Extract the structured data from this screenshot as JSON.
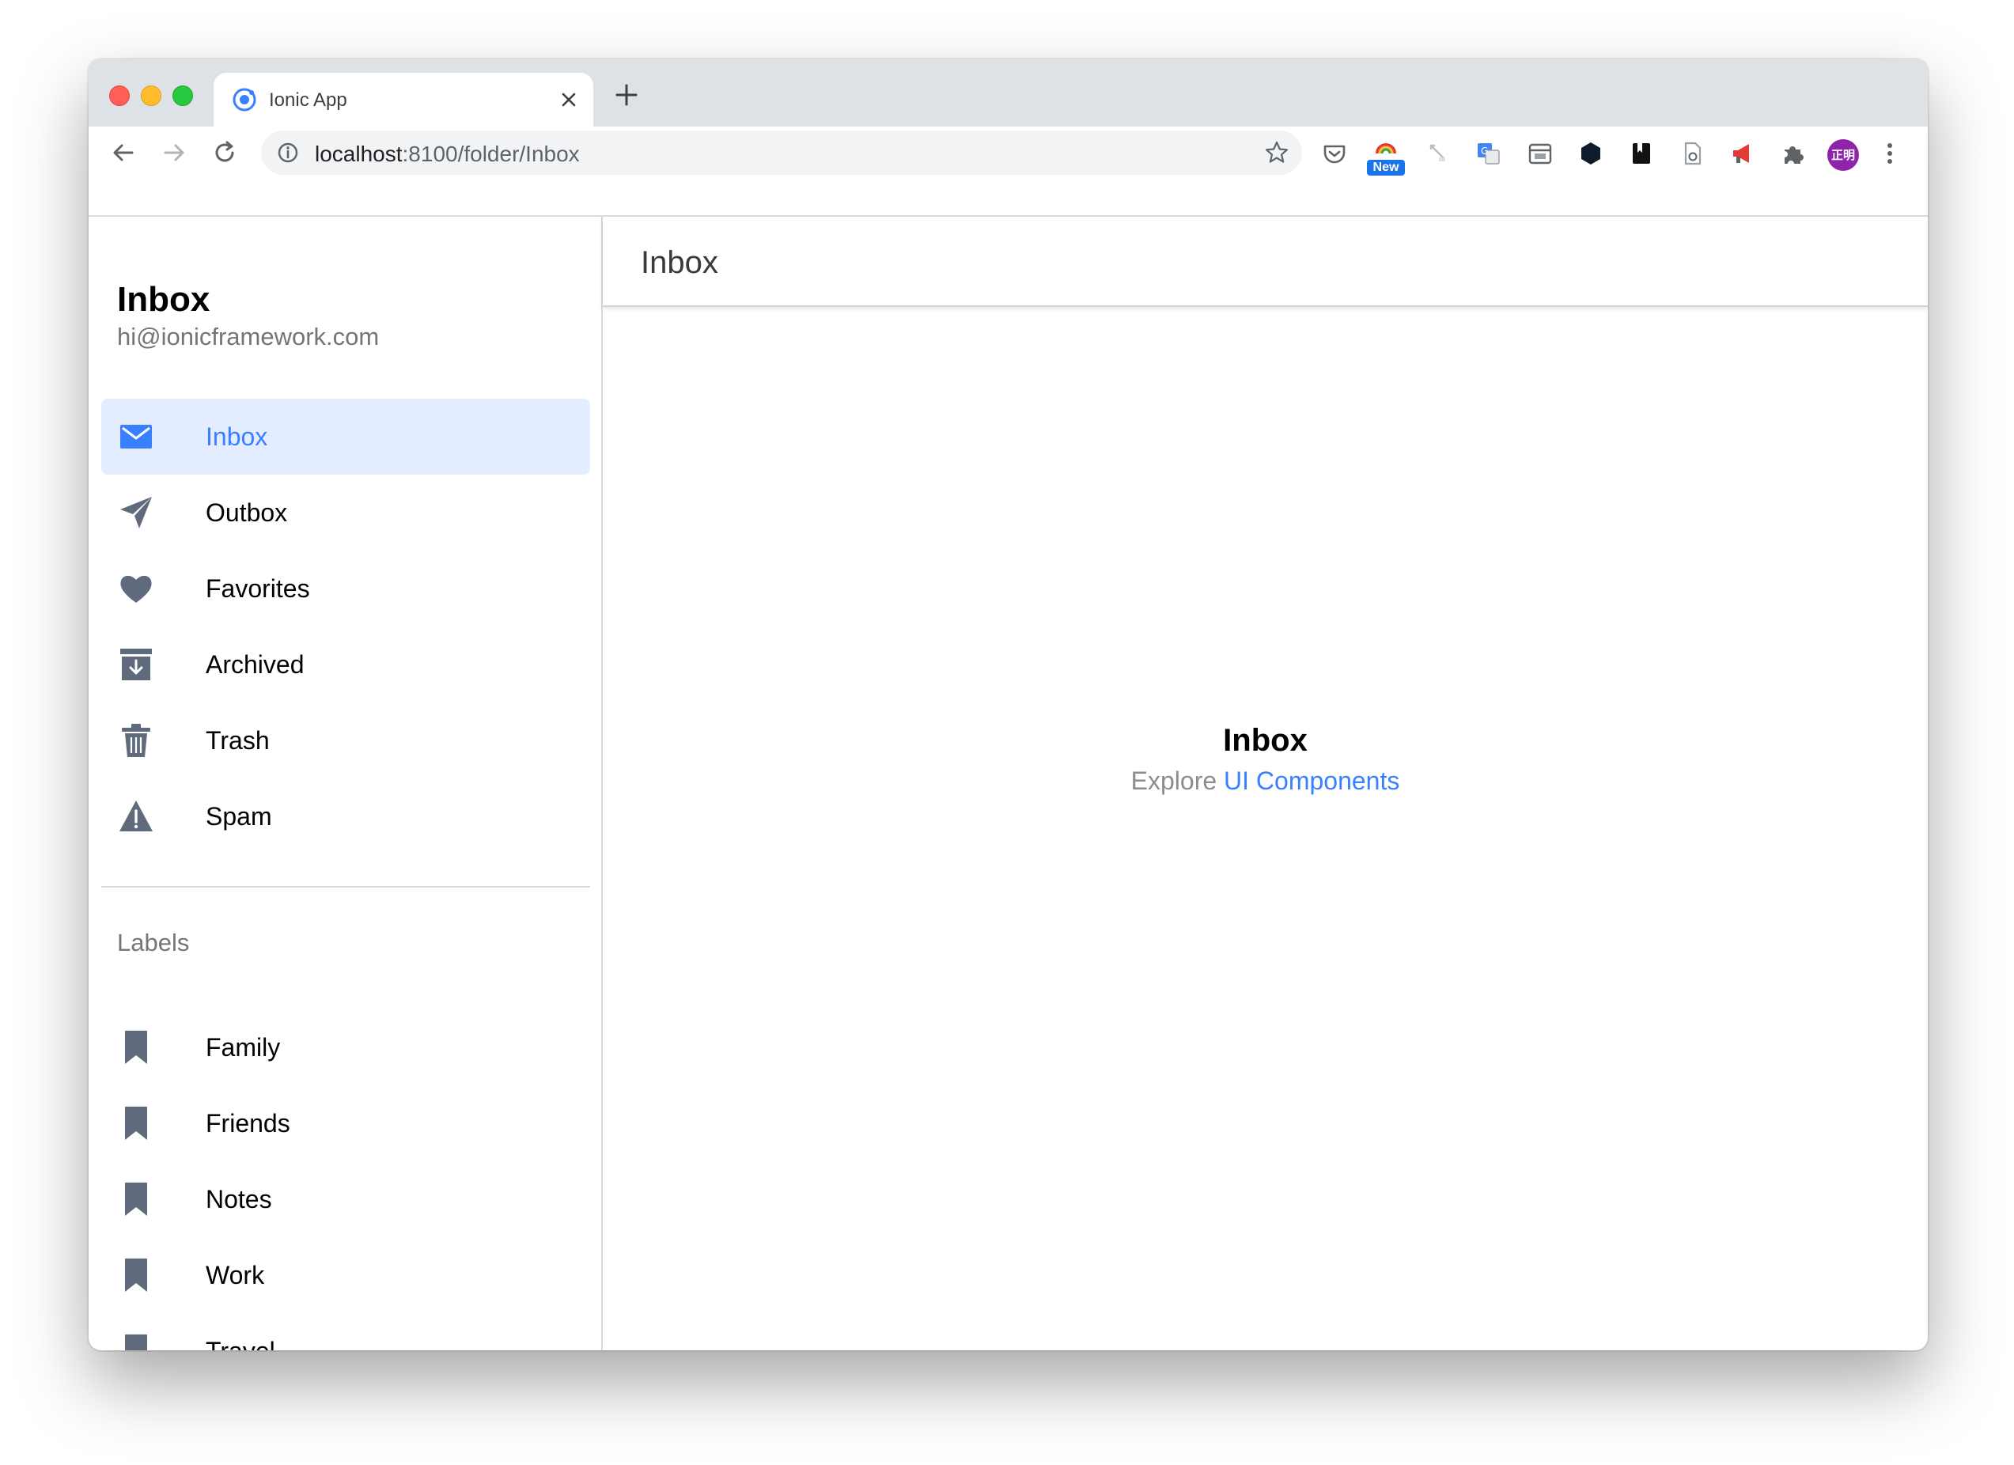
{
  "browser": {
    "tab_title": "Ionic App",
    "url_host": "localhost",
    "url_path": ":8100/folder/Inbox",
    "new_badge": "New",
    "avatar_text": "正明"
  },
  "menu": {
    "title": "Inbox",
    "note": "hi@ionicframework.com",
    "items": [
      {
        "label": "Inbox",
        "icon": "mail-icon"
      },
      {
        "label": "Outbox",
        "icon": "paper-plane-icon"
      },
      {
        "label": "Favorites",
        "icon": "heart-icon"
      },
      {
        "label": "Archived",
        "icon": "archive-icon"
      },
      {
        "label": "Trash",
        "icon": "trash-icon"
      },
      {
        "label": "Spam",
        "icon": "warning-icon"
      }
    ],
    "labels_header": "Labels",
    "labels": [
      {
        "label": "Family",
        "icon": "bookmark-icon"
      },
      {
        "label": "Friends",
        "icon": "bookmark-icon"
      },
      {
        "label": "Notes",
        "icon": "bookmark-icon"
      },
      {
        "label": "Work",
        "icon": "bookmark-icon"
      },
      {
        "label": "Travel",
        "icon": "bookmark-icon"
      }
    ]
  },
  "content": {
    "title": "Inbox",
    "heading": "Inbox",
    "explore_text": "Explore",
    "link_text": "UI Components"
  },
  "colors": {
    "primary": "#3880ff",
    "icon_gray": "#5f6b7c",
    "selected_bg": "#e3edff"
  }
}
